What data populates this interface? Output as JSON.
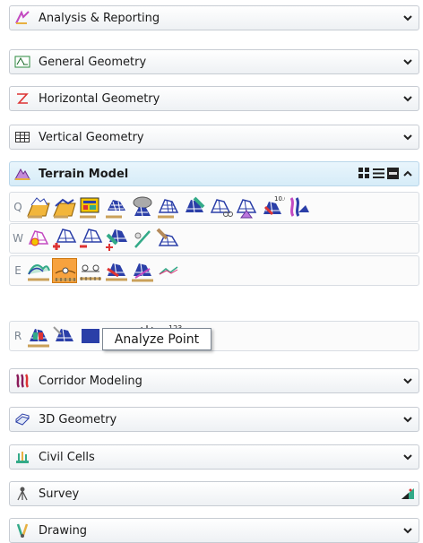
{
  "sections_top": [
    {
      "label": "Analysis & Reporting",
      "icon": "analysis-icon"
    },
    {
      "label": "General Geometry",
      "icon": "general-geometry-icon"
    },
    {
      "label": "Horizontal Geometry",
      "icon": "horizontal-geometry-icon"
    },
    {
      "label": "Vertical Geometry",
      "icon": "vertical-geometry-icon"
    }
  ],
  "active_section": {
    "label": "Terrain Model",
    "icon": "terrain-model-icon"
  },
  "tool_groups": [
    {
      "key": "Q",
      "tool_count": 10
    },
    {
      "key": "W",
      "tool_count": 6
    },
    {
      "key": "E",
      "tool_count": 6,
      "selected_tool": "analyze-point"
    },
    {
      "key": "R",
      "tool_count": 5
    }
  ],
  "tooltip": {
    "text": "Analyze Point"
  },
  "sections_bottom": [
    {
      "label": "Corridor Modeling",
      "icon": "corridor-icon"
    },
    {
      "label": "3D Geometry",
      "icon": "3d-geometry-icon"
    },
    {
      "label": "Civil Cells",
      "icon": "civil-cells-icon"
    },
    {
      "label": "Survey",
      "icon": "survey-icon"
    },
    {
      "label": "Drawing",
      "icon": "drawing-icon"
    }
  ],
  "colors": {
    "accent": "#f7a23e",
    "active_header": "#d6ecf8",
    "icon_blue": "#2b3fa8",
    "icon_yellow": "#f3c400"
  }
}
